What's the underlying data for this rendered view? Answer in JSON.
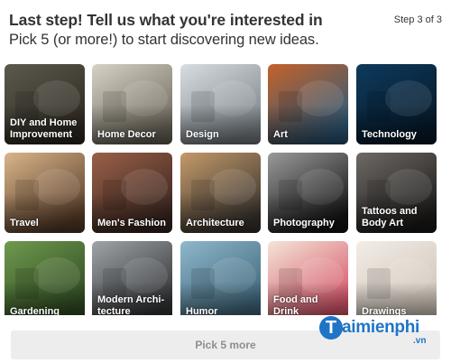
{
  "header": {
    "title": "Last step! Tell us what you're interested in",
    "subtitle": "Pick 5 (or more!) to start discovering new ideas.",
    "step": "Step 3 of 3"
  },
  "topics": [
    {
      "label": "DIY and Home\nImprovement",
      "name": "topic-diy-home-improvement",
      "icon": "wood-lamp-image",
      "colors": [
        "#5b5a4e",
        "#2f2a22"
      ]
    },
    {
      "label": "Home Decor",
      "name": "topic-home-decor",
      "icon": "living-room-image",
      "colors": [
        "#d7d2c6",
        "#6f6a5e"
      ]
    },
    {
      "label": "Design",
      "name": "topic-design",
      "icon": "white-interior-image",
      "colors": [
        "#d8dde0",
        "#7d858b"
      ]
    },
    {
      "label": "Art",
      "name": "topic-art",
      "icon": "paint-brushes-image",
      "colors": [
        "#c4622a",
        "#2d5a7a"
      ]
    },
    {
      "label": "Technology",
      "name": "topic-technology",
      "icon": "circuit-board-image",
      "colors": [
        "#0e3a5c",
        "#061a2b"
      ]
    },
    {
      "label": "Travel",
      "name": "topic-travel",
      "icon": "temples-balloon-image",
      "colors": [
        "#d9b58a",
        "#5a3e2a"
      ]
    },
    {
      "label": "Men's Fashion",
      "name": "topic-mens-fashion",
      "icon": "man-in-suit-image",
      "colors": [
        "#9a6048",
        "#3a2620"
      ]
    },
    {
      "label": "Architecture",
      "name": "topic-architecture",
      "icon": "spiral-building-image",
      "colors": [
        "#c49a6a",
        "#3a3530"
      ]
    },
    {
      "label": "Photography",
      "name": "topic-photography",
      "icon": "woman-hat-portrait-image",
      "colors": [
        "#9a9a9a",
        "#151515"
      ]
    },
    {
      "label": "Tattoos and\nBody Art",
      "name": "topic-tattoos-body-art",
      "icon": "tattooed-arm-image",
      "colors": [
        "#6e6a66",
        "#1c1a19"
      ]
    },
    {
      "label": "Gardening",
      "name": "topic-gardening",
      "icon": "plant-pruning-image",
      "colors": [
        "#6f9a4e",
        "#2f4a22"
      ]
    },
    {
      "label": "Modern Archi-\ntecture",
      "name": "topic-modern-architecture",
      "icon": "dark-house-image",
      "colors": [
        "#9fa4a8",
        "#303234"
      ]
    },
    {
      "label": "Humor",
      "name": "topic-humor",
      "icon": "rock-hand-sculptures-image",
      "colors": [
        "#8fb8cc",
        "#3e6478"
      ]
    },
    {
      "label": "Food and\nDrink",
      "name": "topic-food-drink",
      "icon": "smoothie-image",
      "colors": [
        "#f3e6d6",
        "#d6546a"
      ]
    },
    {
      "label": "Drawings",
      "name": "topic-drawings",
      "icon": "girl-sketch-image",
      "colors": [
        "#f3ede6",
        "#cfc5ba"
      ]
    }
  ],
  "footer": {
    "button_label": "Pick 5 more"
  },
  "watermark": {
    "logo_letter": "T",
    "text": "aimienphi",
    "suffix": ".vn",
    "color": "#1f74c6"
  }
}
